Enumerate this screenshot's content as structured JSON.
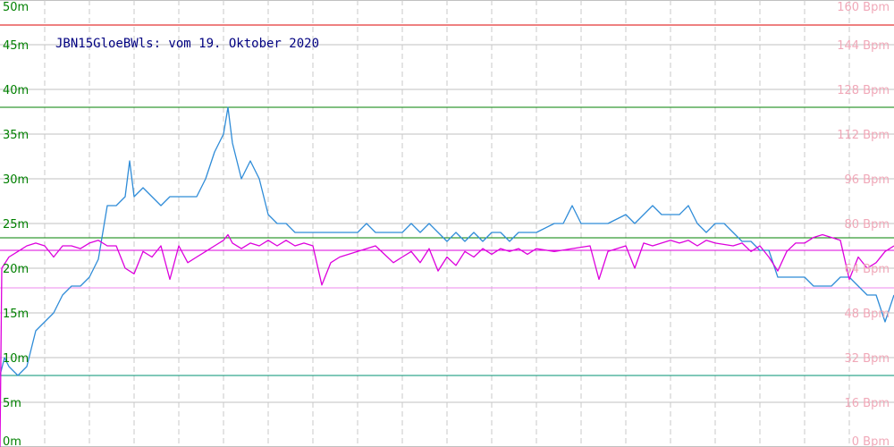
{
  "colors": {
    "background": "#ffffff",
    "grid_horizontal": "#c0c0c0",
    "grid_vertical": "#c8c8c8",
    "depth_line": "#2f8cd8",
    "heartrate_line": "#dd00dd",
    "left_axis_text": "#008000",
    "right_axis_text": "#f0a8b8",
    "title_text": "#000080",
    "ref_red": "#dd0000",
    "ref_green": "#008000",
    "ref_teal": "#009070",
    "ref_magenta": "#dd00dd",
    "ref_pink": "#ee88ee"
  },
  "chart_data": {
    "type": "line",
    "title": "JBN15GloeBWls: vom 19. Oktober 2020",
    "xlabel": "",
    "ylabel": "",
    "grid": true,
    "x_range": [
      0,
      100
    ],
    "y_left": {
      "range": [
        0,
        50
      ],
      "ticks": [
        0,
        5,
        10,
        15,
        20,
        25,
        30,
        35,
        40,
        45,
        50
      ],
      "tick_labels": [
        "0m",
        "5m",
        "10m",
        "15m",
        "20m",
        "25m",
        "30m",
        "35m",
        "40m",
        "45m",
        "50m"
      ]
    },
    "y_right": {
      "range": [
        0,
        160
      ],
      "ticks": [
        0,
        16,
        32,
        48,
        64,
        80,
        96,
        112,
        128,
        144,
        160
      ],
      "tick_labels": [
        "0 Bpm",
        "16 Bpm",
        "32 Bpm",
        "48 Bpm",
        "64 Bpm",
        "80 Bpm",
        "96 Bpm",
        "112 Bpm",
        "128 Bpm",
        "144 Bpm",
        "160 Bpm"
      ]
    },
    "reference_lines": [
      {
        "axis": "left",
        "value": 47.2,
        "color_key": "ref_red"
      },
      {
        "axis": "left",
        "value": 38.0,
        "color_key": "ref_green"
      },
      {
        "axis": "left",
        "value": 23.4,
        "color_key": "ref_green"
      },
      {
        "axis": "left",
        "value": 22.0,
        "color_key": "ref_magenta"
      },
      {
        "axis": "left",
        "value": 17.8,
        "color_key": "ref_pink"
      },
      {
        "axis": "left",
        "value": 8.0,
        "color_key": "ref_teal"
      }
    ],
    "series": [
      {
        "axis": "left",
        "color_key": "depth_line",
        "points": [
          [
            0,
            8
          ],
          [
            0.5,
            10
          ],
          [
            1,
            9
          ],
          [
            2,
            8
          ],
          [
            3,
            9
          ],
          [
            4,
            13
          ],
          [
            6,
            15
          ],
          [
            7,
            17
          ],
          [
            8,
            18
          ],
          [
            9,
            18
          ],
          [
            10,
            19
          ],
          [
            11,
            21
          ],
          [
            12,
            27
          ],
          [
            13,
            27
          ],
          [
            14,
            28
          ],
          [
            14.5,
            32
          ],
          [
            15,
            28
          ],
          [
            16,
            29
          ],
          [
            17,
            28
          ],
          [
            18,
            27
          ],
          [
            19,
            28
          ],
          [
            21,
            28
          ],
          [
            22,
            28
          ],
          [
            23,
            30
          ],
          [
            24,
            33
          ],
          [
            25,
            35
          ],
          [
            25.5,
            38
          ],
          [
            26,
            34
          ],
          [
            27,
            30
          ],
          [
            28,
            32
          ],
          [
            29,
            30
          ],
          [
            30,
            26
          ],
          [
            31,
            25
          ],
          [
            32,
            25
          ],
          [
            33,
            24
          ],
          [
            38,
            24
          ],
          [
            40,
            24
          ],
          [
            41,
            25
          ],
          [
            42,
            24
          ],
          [
            45,
            24
          ],
          [
            46,
            25
          ],
          [
            47,
            24
          ],
          [
            48,
            25
          ],
          [
            49,
            24
          ],
          [
            50,
            23
          ],
          [
            51,
            24
          ],
          [
            52,
            23
          ],
          [
            53,
            24
          ],
          [
            54,
            23
          ],
          [
            55,
            24
          ],
          [
            56,
            24
          ],
          [
            57,
            23
          ],
          [
            58,
            24
          ],
          [
            59,
            24
          ],
          [
            60,
            24
          ],
          [
            62,
            25
          ],
          [
            63,
            25
          ],
          [
            64,
            27
          ],
          [
            65,
            25
          ],
          [
            66,
            25
          ],
          [
            68,
            25
          ],
          [
            70,
            26
          ],
          [
            71,
            25
          ],
          [
            72,
            26
          ],
          [
            73,
            27
          ],
          [
            74,
            26
          ],
          [
            75,
            26
          ],
          [
            76,
            26
          ],
          [
            77,
            27
          ],
          [
            78,
            25
          ],
          [
            79,
            24
          ],
          [
            80,
            25
          ],
          [
            81,
            25
          ],
          [
            82,
            24
          ],
          [
            83,
            23
          ],
          [
            84,
            23
          ],
          [
            85,
            22
          ],
          [
            86,
            22
          ],
          [
            87,
            19
          ],
          [
            88,
            19
          ],
          [
            89,
            19
          ],
          [
            90,
            19
          ],
          [
            91,
            18
          ],
          [
            92,
            18
          ],
          [
            93,
            18
          ],
          [
            94,
            19
          ],
          [
            95,
            19
          ],
          [
            96,
            18
          ],
          [
            97,
            17
          ],
          [
            98,
            17
          ],
          [
            99,
            14
          ],
          [
            100,
            17
          ]
        ]
      },
      {
        "axis": "right",
        "color_key": "heartrate_line",
        "points": [
          [
            0,
            0
          ],
          [
            0.2,
            64
          ],
          [
            1,
            68
          ],
          [
            2,
            70
          ],
          [
            3,
            72
          ],
          [
            4,
            73
          ],
          [
            5,
            72
          ],
          [
            6,
            68
          ],
          [
            7,
            72
          ],
          [
            8,
            72
          ],
          [
            9,
            71
          ],
          [
            10,
            73
          ],
          [
            11,
            74
          ],
          [
            12,
            72
          ],
          [
            13,
            72
          ],
          [
            14,
            64
          ],
          [
            15,
            62
          ],
          [
            16,
            70
          ],
          [
            17,
            68
          ],
          [
            18,
            72
          ],
          [
            19,
            60
          ],
          [
            20,
            72
          ],
          [
            21,
            66
          ],
          [
            22,
            68
          ],
          [
            23,
            70
          ],
          [
            24,
            72
          ],
          [
            25,
            74
          ],
          [
            25.5,
            76
          ],
          [
            26,
            73
          ],
          [
            27,
            71
          ],
          [
            28,
            73
          ],
          [
            29,
            72
          ],
          [
            30,
            74
          ],
          [
            31,
            72
          ],
          [
            32,
            74
          ],
          [
            33,
            72
          ],
          [
            34,
            73
          ],
          [
            35,
            72
          ],
          [
            36,
            58
          ],
          [
            37,
            66
          ],
          [
            38,
            68
          ],
          [
            39,
            69
          ],
          [
            40,
            70
          ],
          [
            41,
            71
          ],
          [
            42,
            72
          ],
          [
            43,
            69
          ],
          [
            44,
            66
          ],
          [
            45,
            68
          ],
          [
            46,
            70
          ],
          [
            47,
            66
          ],
          [
            48,
            71
          ],
          [
            49,
            63
          ],
          [
            50,
            68
          ],
          [
            51,
            65
          ],
          [
            52,
            70
          ],
          [
            53,
            68
          ],
          [
            54,
            71
          ],
          [
            55,
            69
          ],
          [
            56,
            71
          ],
          [
            57,
            70
          ],
          [
            58,
            71
          ],
          [
            59,
            69
          ],
          [
            60,
            71
          ],
          [
            62,
            70
          ],
          [
            64,
            71
          ],
          [
            66,
            72
          ],
          [
            67,
            60
          ],
          [
            68,
            70
          ],
          [
            69,
            71
          ],
          [
            70,
            72
          ],
          [
            71,
            64
          ],
          [
            72,
            73
          ],
          [
            73,
            72
          ],
          [
            74,
            73
          ],
          [
            75,
            74
          ],
          [
            76,
            73
          ],
          [
            77,
            74
          ],
          [
            78,
            72
          ],
          [
            79,
            74
          ],
          [
            80,
            73
          ],
          [
            82,
            72
          ],
          [
            83,
            73
          ],
          [
            84,
            70
          ],
          [
            85,
            72
          ],
          [
            86,
            68
          ],
          [
            87,
            63
          ],
          [
            88,
            70
          ],
          [
            89,
            73
          ],
          [
            90,
            73
          ],
          [
            91,
            75
          ],
          [
            92,
            76
          ],
          [
            93,
            75
          ],
          [
            94,
            74
          ],
          [
            95,
            60
          ],
          [
            96,
            68
          ],
          [
            97,
            64
          ],
          [
            98,
            66
          ],
          [
            99,
            70
          ],
          [
            100,
            72
          ]
        ]
      }
    ]
  }
}
